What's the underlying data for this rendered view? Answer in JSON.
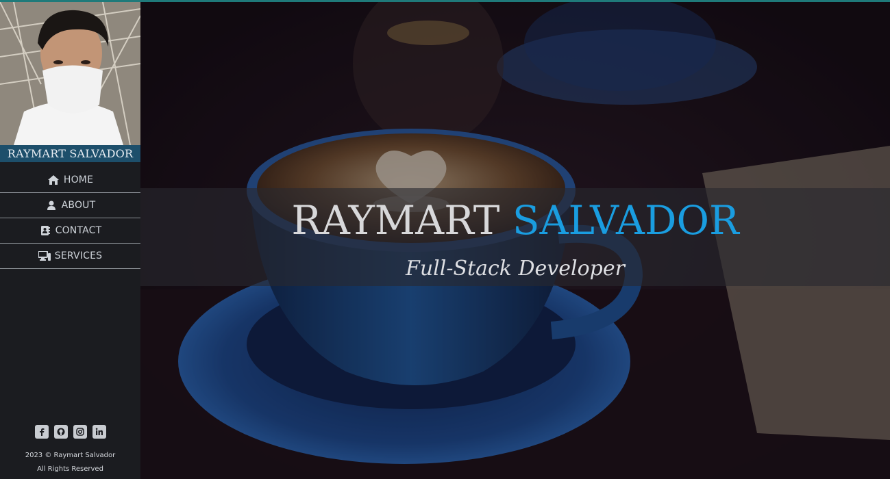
{
  "sidebar": {
    "profile_name": "RAYMART SALVADOR",
    "nav": [
      {
        "label": "HOME",
        "icon": "home-icon"
      },
      {
        "label": "ABOUT",
        "icon": "user-icon"
      },
      {
        "label": "CONTACT",
        "icon": "address-book-icon"
      },
      {
        "label": "SERVICES",
        "icon": "desktop-icon"
      }
    ],
    "social": [
      "facebook-icon",
      "github-icon",
      "instagram-icon",
      "linkedin-icon"
    ],
    "footer": {
      "copyright": "2023 © Raymart Salvador",
      "rights": "All Rights Reserved"
    }
  },
  "hero": {
    "title_first": "RAYMART",
    "title_second": "SALVADOR",
    "subtitle": "Full-Stack Developer"
  },
  "colors": {
    "accent": "#1a9de0",
    "name_bar": "#1d4f6b",
    "sidebar_bg": "#1b1c20"
  }
}
